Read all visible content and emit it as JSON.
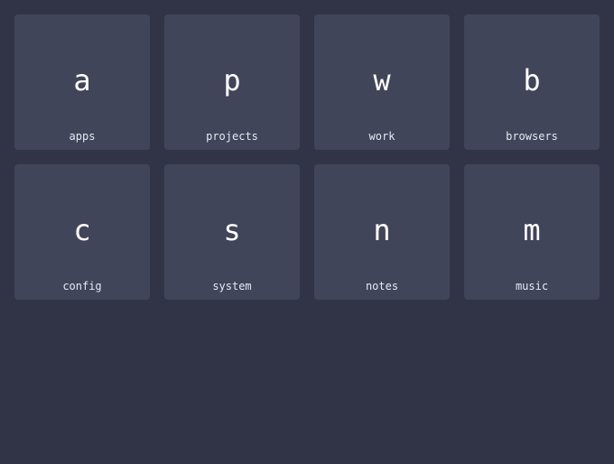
{
  "colors": {
    "background": "#303446",
    "tile": "#414559",
    "key_text": "#ffffff",
    "label_text": "#e6e9f5"
  },
  "tiles": [
    {
      "key": "a",
      "label": "apps"
    },
    {
      "key": "p",
      "label": "projects"
    },
    {
      "key": "w",
      "label": "work"
    },
    {
      "key": "b",
      "label": "browsers"
    },
    {
      "key": "c",
      "label": "config"
    },
    {
      "key": "s",
      "label": "system"
    },
    {
      "key": "n",
      "label": "notes"
    },
    {
      "key": "m",
      "label": "music"
    }
  ]
}
